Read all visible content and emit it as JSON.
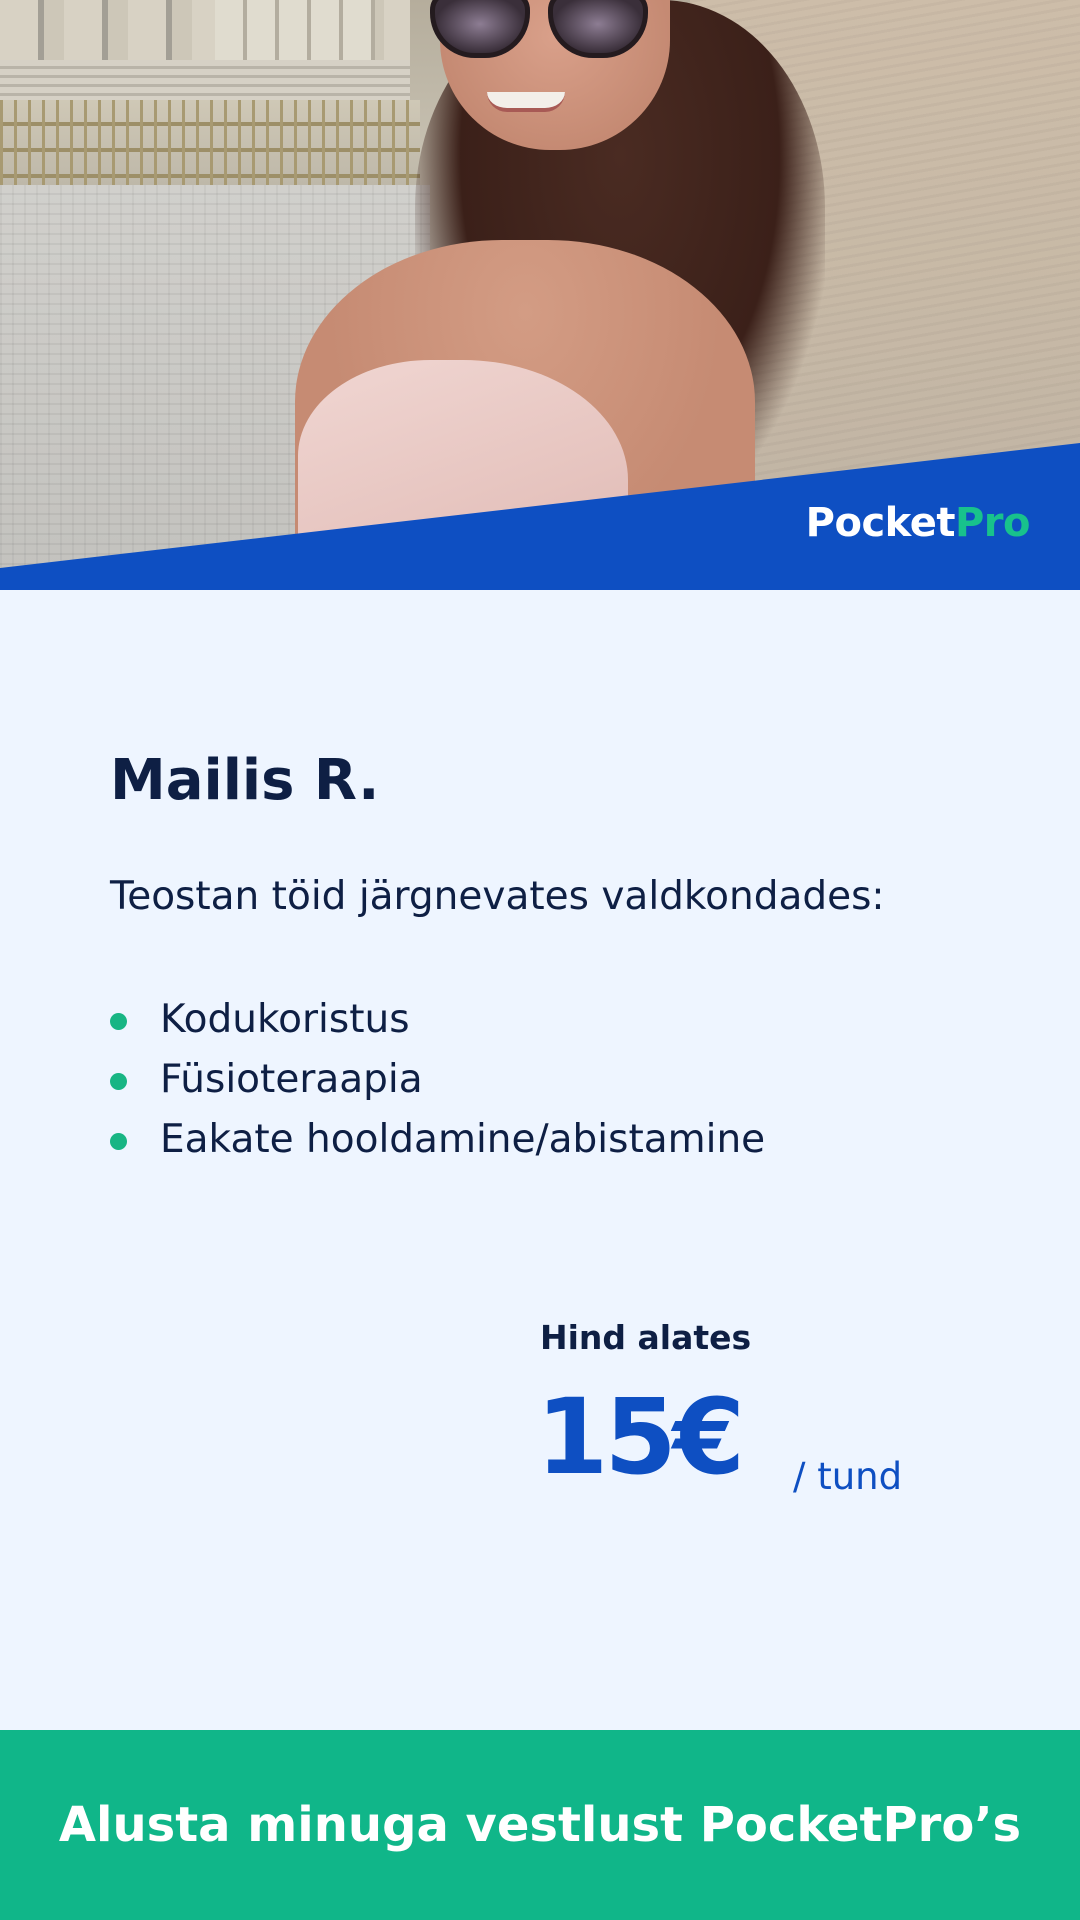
{
  "brand": {
    "logo_part1": "Pocket",
    "logo_part2": "Pro",
    "primary_color": "#0e4fc2",
    "accent_color": "#10b689"
  },
  "profile": {
    "name": "Mailis R.",
    "intro": "Teostan töid järgnevates valdkondades:",
    "services": [
      "Kodukoristus",
      "Füsioteraapia",
      "Eakate hooldamine/abistamine"
    ]
  },
  "price": {
    "label": "Hind alates",
    "value": "15€",
    "unit": "/ tund"
  },
  "cta": {
    "label": "Alusta minuga vestlust PocketPro’s"
  }
}
